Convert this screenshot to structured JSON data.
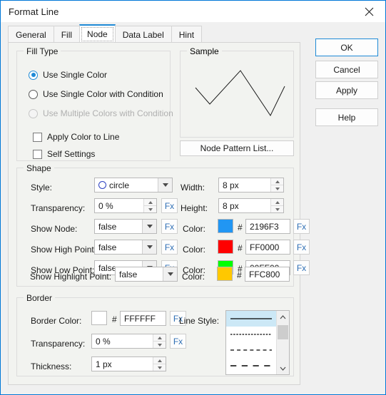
{
  "window": {
    "title": "Format Line",
    "close_icon": "close-icon"
  },
  "tabs": [
    {
      "label": "General",
      "selected": false
    },
    {
      "label": "Fill",
      "selected": false
    },
    {
      "label": "Node",
      "selected": true
    },
    {
      "label": "Data Label",
      "selected": false
    },
    {
      "label": "Hint",
      "selected": false
    }
  ],
  "side_buttons": [
    {
      "label": "OK"
    },
    {
      "label": "Cancel"
    },
    {
      "label": "Apply"
    },
    {
      "label": "Help"
    }
  ],
  "fill_type": {
    "legend": "Fill Type",
    "options": [
      {
        "label": "Use Single Color",
        "checked": true,
        "disabled": false
      },
      {
        "label": "Use Single Color with Condition",
        "checked": false,
        "disabled": false
      },
      {
        "label": "Use Multiple Colors with Condition",
        "checked": false,
        "disabled": true
      }
    ],
    "checkboxes": [
      {
        "label": "Apply Color to Line",
        "checked": false
      },
      {
        "label": "Self Settings",
        "checked": false
      }
    ]
  },
  "sample": {
    "legend": "Sample",
    "node_pattern_button": "Node Pattern List...",
    "line_color": "#000000"
  },
  "shape": {
    "legend": "Shape",
    "style_label": "Style:",
    "style_value": "circle",
    "style_glyph_color": "#2a3fc0",
    "transparency_label": "Transparency:",
    "transparency_value": "0 %",
    "show_node_label": "Show Node:",
    "show_node_value": "false",
    "show_high_point_label": "Show High Point:",
    "show_high_point_value": "false",
    "show_low_point_label": "Show Low Point:",
    "show_low_point_value": "false",
    "show_highlight_point_label": "Show Highlight Point:",
    "show_highlight_point_value": "false",
    "width_label": "Width:",
    "width_value": "8 px",
    "height_label": "Height:",
    "height_value": "8 px",
    "color_label_1": "Color:",
    "color_value_1": "2196F3",
    "color_swatch_1": "#2196F3",
    "color_label_2": "Color:",
    "color_value_2": "FF0000",
    "color_swatch_2": "#FF0000",
    "color_label_3": "Color:",
    "color_value_3": "00FF00",
    "color_swatch_3": "#00FF00",
    "color_label_4": "Color:",
    "color_value_4": "FFC800",
    "color_swatch_4": "#FFC800",
    "fx_label": "Fx",
    "hash": "#"
  },
  "border": {
    "legend": "Border",
    "border_color_label": "Border Color:",
    "border_color_value": "FFFFFF",
    "border_color_swatch": "#FFFFFF",
    "transparency_label": "Transparency:",
    "transparency_value": "0 %",
    "thickness_label": "Thickness:",
    "thickness_value": "1 px",
    "line_style_label": "Line Style:",
    "fx_label": "Fx",
    "hash": "#",
    "line_styles": [
      {
        "name": "solid",
        "dash": "none",
        "selected": true
      },
      {
        "name": "fine-dashed",
        "dash": "4,3",
        "selected": false
      },
      {
        "name": "medium-dashed",
        "dash": "8,6",
        "selected": false
      },
      {
        "name": "long-dashed",
        "dash": "14,10",
        "selected": false
      }
    ],
    "scroll_up_icon": "chevron-up-icon",
    "scroll_down_icon": "chevron-down-icon"
  }
}
